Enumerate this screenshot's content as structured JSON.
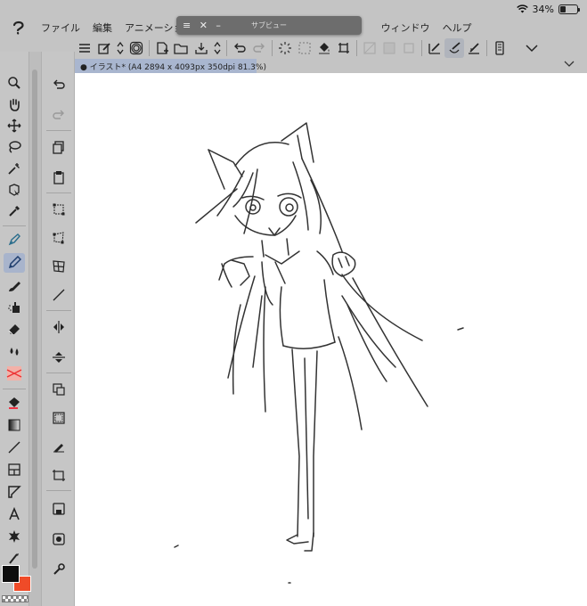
{
  "status": {
    "battery": "34%",
    "battery_fraction": 0.34
  },
  "menu": [
    {
      "id": "file",
      "label": "ファイル"
    },
    {
      "id": "edit",
      "label": "編集"
    },
    {
      "id": "animation",
      "label": "アニメーショ"
    },
    {
      "id": "window",
      "label": "ウィンドウ"
    },
    {
      "id": "help",
      "label": "ヘルプ"
    }
  ],
  "subview": {
    "title": "サブビュー"
  },
  "canvas_tab": {
    "label": "● イラスト* (A4 2894 x 4093px 350dpi 81.3%)"
  },
  "colors": {
    "main": "#0d0d0d",
    "sub": "#ef4b28",
    "accent": "#a8b4cc"
  },
  "tools": [
    "zoom-icon",
    "hand-icon",
    "move-icon",
    "lasso-select-icon",
    "magic-wand-icon",
    "object-select-icon",
    "eyedropper-icon",
    "pen-icon",
    "pencil-icon",
    "brush-icon",
    "airbrush-icon",
    "eraser-icon",
    "blend-icon",
    "deco-icon",
    "fill-icon",
    "gradient-icon",
    "line-figure-icon",
    "frame-border-icon",
    "ruler-icon",
    "text-icon",
    "balloon-icon",
    "correct-line-icon"
  ],
  "commands": [
    "undo-icon",
    "redo-icon",
    "copy-icon",
    "paste-icon",
    "transform-icon",
    "free-transform-icon",
    "mesh-icon",
    "straight-line-icon",
    "flip-horizontal-icon",
    "flip-vertical-icon",
    "clear-selection-icon",
    "convert-selection-icon",
    "fill-selection-icon",
    "crop-icon",
    "save-icon",
    "record-icon",
    "settings-icon"
  ]
}
